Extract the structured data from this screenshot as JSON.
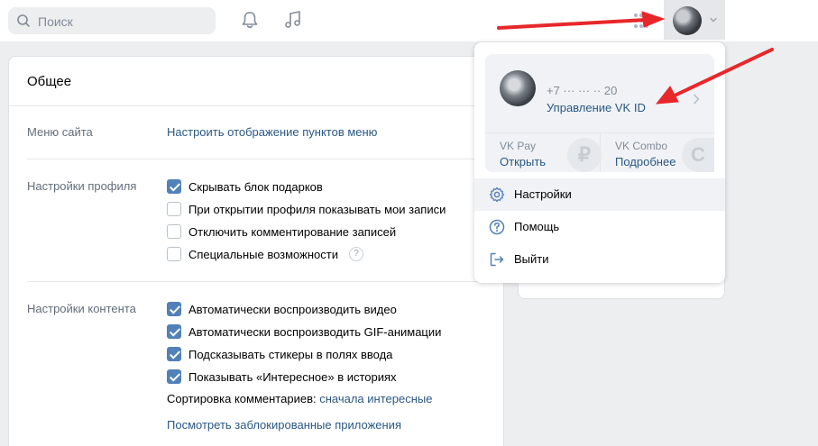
{
  "header": {
    "search_placeholder": "Поиск",
    "icons": [
      "search-icon",
      "bell-icon",
      "music-icon",
      "apps-grid-icon",
      "chevron-down-icon"
    ]
  },
  "settings": {
    "title": "Общее",
    "site_menu": {
      "label": "Меню сайта",
      "link": "Настроить отображение пунктов меню"
    },
    "profile": {
      "label": "Настройки профиля",
      "options": [
        {
          "text": "Скрывать блок подарков",
          "checked": true
        },
        {
          "text": "При открытии профиля показывать мои записи",
          "checked": false
        },
        {
          "text": "Отключить комментирование записей",
          "checked": false
        },
        {
          "text": "Специальные возможности",
          "checked": false,
          "help": "?"
        }
      ]
    },
    "content": {
      "label": "Настройки контента",
      "options": [
        {
          "text": "Автоматически воспроизводить видео",
          "checked": true
        },
        {
          "text": "Автоматически воспроизводить GIF-анимации",
          "checked": true
        },
        {
          "text": "Подсказывать стикеры в полях ввода",
          "checked": true
        },
        {
          "text": "Показывать «Интересное» в историях",
          "checked": true
        }
      ],
      "sort_label": "Сортировка комментариев:",
      "sort_value": "сначала интересные",
      "blocked_apps_link": "Посмотреть заблокированные приложения"
    }
  },
  "dropdown": {
    "phone": "+7 ··· ··· ·· 20",
    "manage_link": "Управление VK ID",
    "services": [
      {
        "name": "VK Pay",
        "action": "Открыть",
        "icon": "ruble-icon"
      },
      {
        "name": "VK Combo",
        "action": "Подробнее",
        "icon": "combo-icon"
      }
    ],
    "menu": [
      {
        "label": "Настройки",
        "icon": "gear-icon"
      },
      {
        "label": "Помощь",
        "icon": "help-circle-icon"
      },
      {
        "label": "Выйти",
        "icon": "logout-icon"
      }
    ]
  },
  "colors": {
    "accent": "#5181b8",
    "link": "#2a5885",
    "annotation": "#e8272a"
  }
}
